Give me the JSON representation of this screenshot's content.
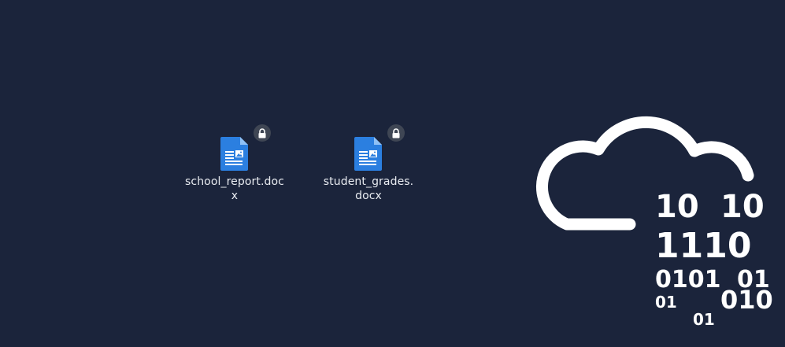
{
  "desktop": {
    "background": "#1b243b",
    "files": [
      {
        "name": "school_report.docx",
        "icon": "document-icon",
        "locked": true
      },
      {
        "name": "student_grades.\ndocx",
        "icon": "document-icon",
        "locked": true
      }
    ],
    "wallpaper": {
      "icon": "cloud-binary-icon",
      "binary": [
        "10",
        "10",
        "1110",
        "0101",
        "01",
        "01",
        "010",
        "01"
      ]
    }
  }
}
